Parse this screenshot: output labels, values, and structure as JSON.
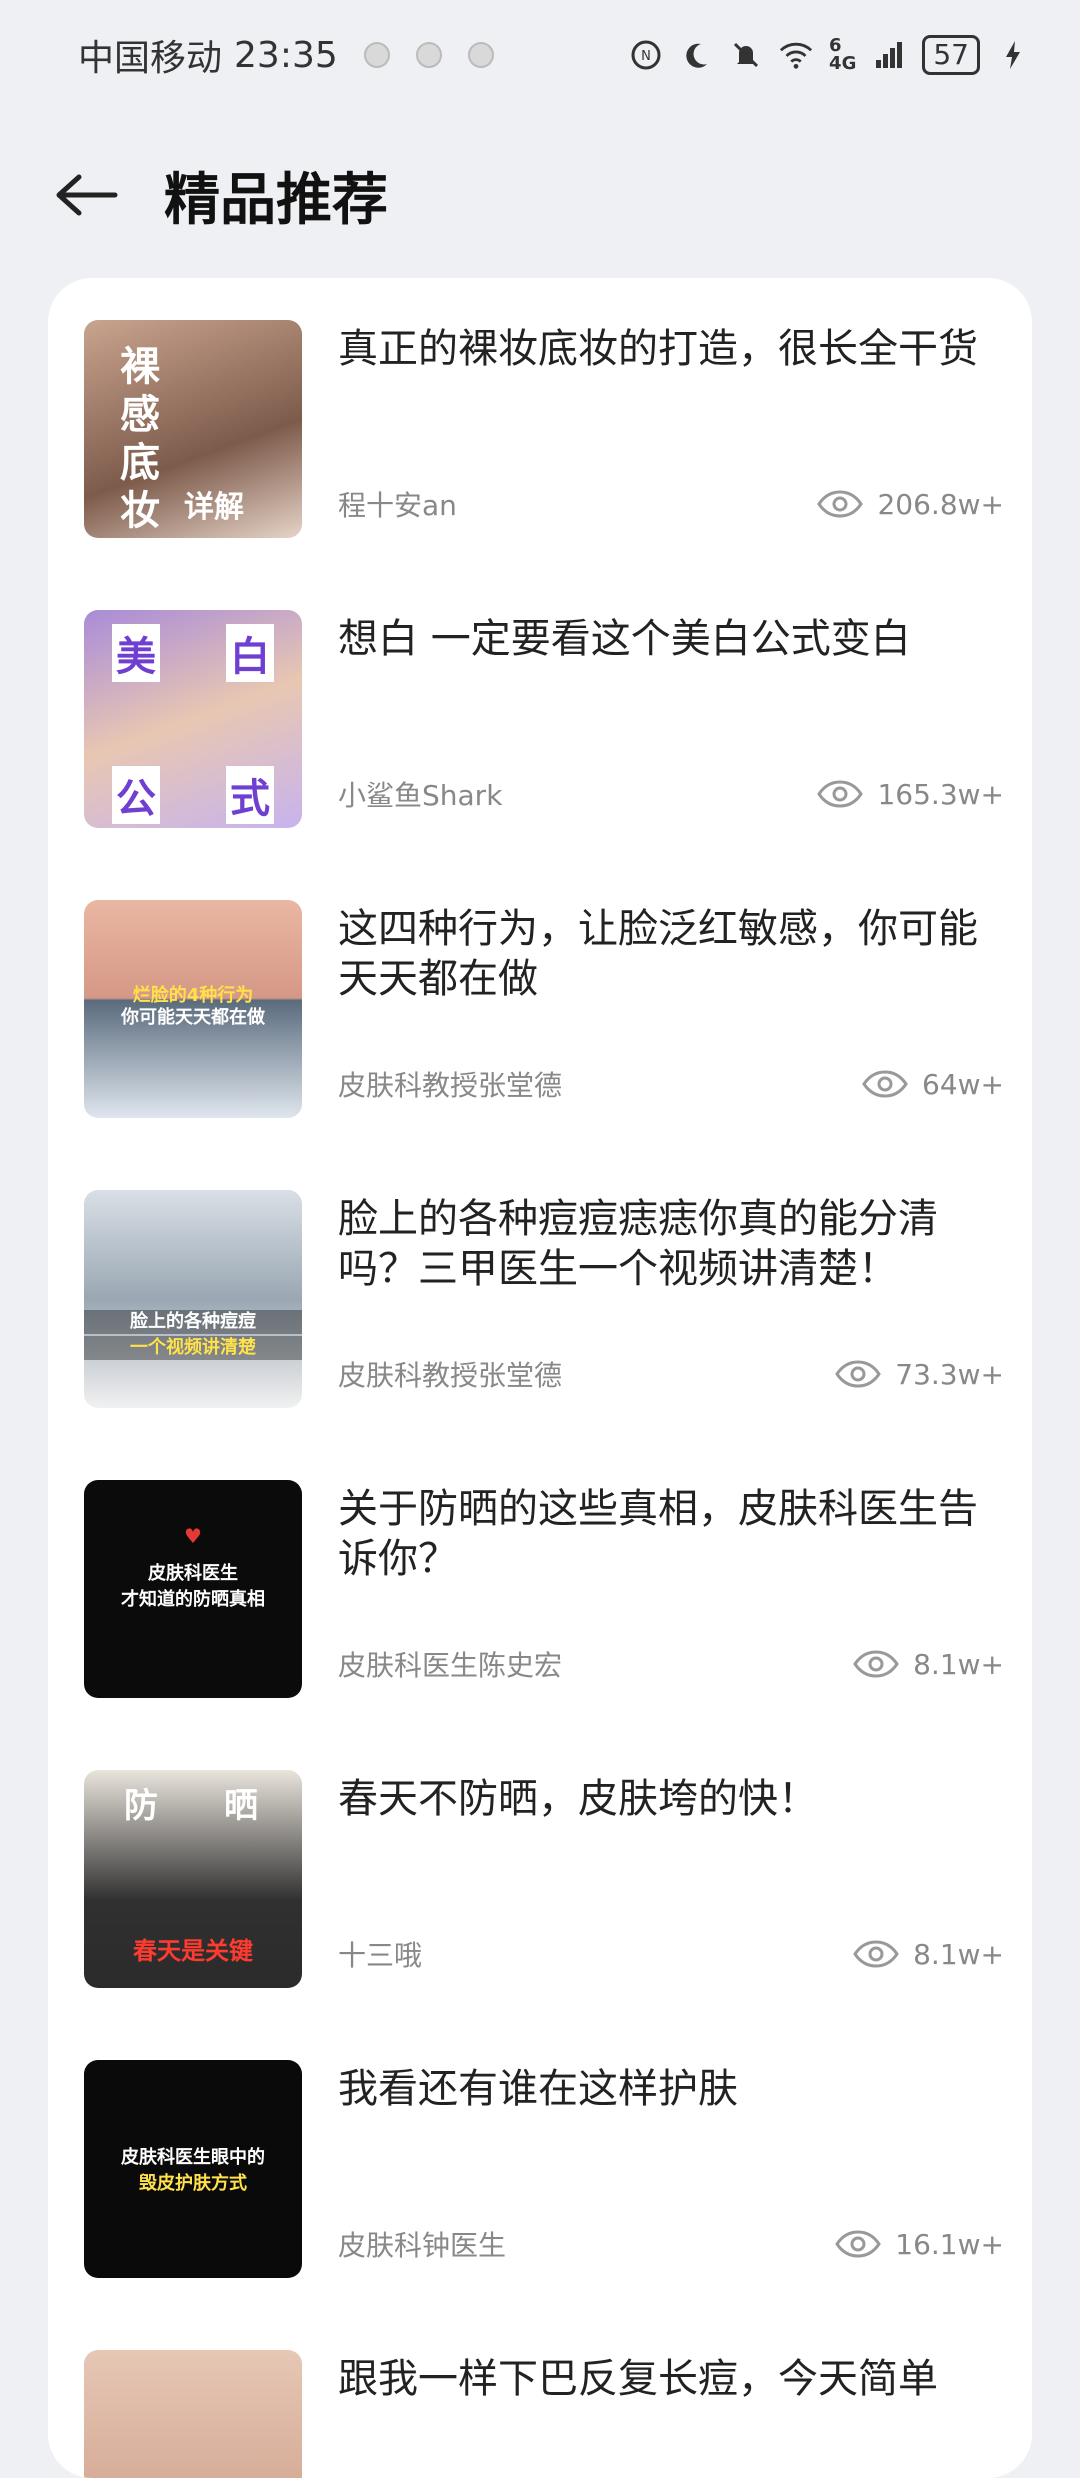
{
  "status_bar": {
    "carrier": "中国移动",
    "time": "23:35",
    "network": "4G",
    "signal_sup": "6",
    "battery": "57"
  },
  "header": {
    "title": "精品推荐"
  },
  "items": [
    {
      "title": "真正的裸妆底妆的打造，很长全干货",
      "author": "程十安an",
      "views": "206.8w+",
      "thumb_text": [
        "裸",
        "感",
        "底",
        "妆",
        "详解"
      ]
    },
    {
      "title": "想白 一定要看这个美白公式变白",
      "author": "小鲨鱼Shark",
      "views": "165.3w+",
      "thumb_text": [
        "美",
        "白",
        "公",
        "式"
      ]
    },
    {
      "title": "这四种行为，让脸泛红敏感，你可能天天都在做",
      "author": "皮肤科教授张堂德",
      "views": "64w+",
      "thumb_text": [
        "烂脸的4种行为",
        "你可能天天都在做"
      ]
    },
    {
      "title": "脸上的各种痘痘痣痣你真的能分清吗？三甲医生一个视频讲清楚！",
      "author": "皮肤科教授张堂德",
      "views": "73.3w+",
      "thumb_text": [
        "脸上的各种痘痘",
        "一个视频讲清楚"
      ]
    },
    {
      "title": "关于防晒的这些真相，皮肤科医生告诉你？",
      "author": "皮肤科医生陈史宏",
      "views": "8.1w+",
      "thumb_text": [
        "皮肤科医生",
        "才知道的防晒真相"
      ]
    },
    {
      "title": "春天不防晒，皮肤垮的快！",
      "author": "十三哦",
      "views": "8.1w+",
      "thumb_text": [
        "防",
        "晒",
        "春天是关键"
      ]
    },
    {
      "title": "我看还有谁在这样护肤",
      "author": "皮肤科钟医生",
      "views": "16.1w+",
      "thumb_text": [
        "皮肤科医生眼中的",
        "毁皮护肤方式"
      ]
    },
    {
      "title": "跟我一样下巴反复长痘，今天简单",
      "author": "",
      "views": "",
      "thumb_text": []
    }
  ]
}
